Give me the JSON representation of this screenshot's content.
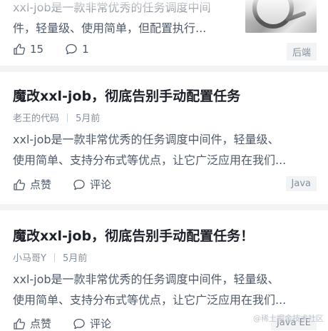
{
  "cards": [
    {
      "excerpt_lines": [
        "xxl-job是一款非常优秀的任务调度中间",
        "件，轻量级、使用简单，但配置执行..."
      ],
      "likes": "15",
      "comments": "1",
      "tag": "后端"
    },
    {
      "title": "魔改xxl-job，彻底告别手动配置任务",
      "author": "老王的代码",
      "time": "5月前",
      "excerpt_lines": [
        "xxl-job是一款非常优秀的任务调度中间件，轻量级、",
        "使用简单、支持分布式等优点，让它广泛应用在我们..."
      ],
      "like_label": "点赞",
      "comment_label": "评论",
      "tag": "Java"
    },
    {
      "title": "魔改xxl-job，彻底告别手动配置任务！",
      "author": "小马哥Y",
      "time": "5月前",
      "excerpt_lines": [
        "xxl-job是一款非常优秀的任务调度中间件，轻量级、",
        "使用简单、支持分布式等优点，让它广泛应用在我们..."
      ],
      "like_label": "点赞",
      "comment_label": "评论",
      "tag": "Java EE"
    }
  ],
  "watermark": "@稀土掘金技术社区"
}
